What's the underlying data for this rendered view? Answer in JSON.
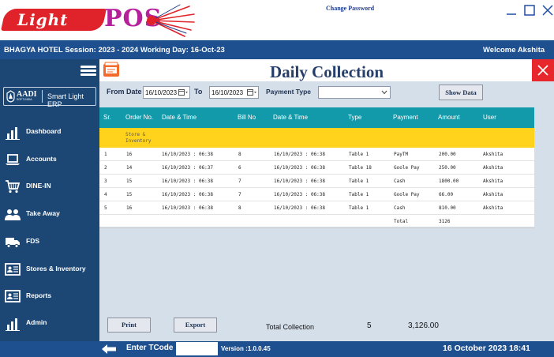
{
  "app": {
    "logo_text_1": "Light",
    "logo_text_2": "POS",
    "change_password": "Change Password"
  },
  "header": {
    "session": "BHAGYA HOTEL  Session:  2023 - 2024 Working Day: 16-Oct-23",
    "welcome": "Welcome  Akshita"
  },
  "sidebar": {
    "brand_short": "AADI",
    "brand_sub": "SOFT-INDIA",
    "brand_name": "Smart Light ERP",
    "items": [
      {
        "label": "Dashboard",
        "icon": "bar-chart-icon"
      },
      {
        "label": "Accounts",
        "icon": "laptop-icon"
      },
      {
        "label": "DINE-IN",
        "icon": "cart-icon"
      },
      {
        "label": "Take Away",
        "icon": "users-icon"
      },
      {
        "label": "FDS",
        "icon": "truck-icon"
      },
      {
        "label": "Stores & Inventory",
        "icon": "id-card-icon"
      },
      {
        "label": "Reports",
        "icon": "report-card-icon"
      },
      {
        "label": "Admin",
        "icon": "admin-chart-icon"
      }
    ]
  },
  "page": {
    "title": "Daily Collection"
  },
  "filters": {
    "from_label": "From Date",
    "from_value": "16/10/2023",
    "to_label": "To",
    "to_value": "16/10/2023",
    "payment_type_label": "Payment Type",
    "payment_type_value": "",
    "show_data_label": "Show Data"
  },
  "grid": {
    "columns": [
      "Sr.",
      "Order No.",
      "Date & Time",
      "Bill No",
      "Date & Time",
      "Type",
      "Payment",
      "Amount",
      "User"
    ],
    "group_label": "Store & Inventory",
    "rows": [
      [
        "1",
        "16",
        "16/10/2023 : 06:38",
        "8",
        "16/10/2023 : 06:38",
        "Table 1",
        "PayTM",
        "200.00",
        "Akshita"
      ],
      [
        "2",
        "14",
        "16/10/2023 : 06:37",
        "6",
        "16/10/2023 : 06:38",
        "Table 18",
        "Goole Pay",
        "250.00",
        "Akshita"
      ],
      [
        "3",
        "15",
        "16/10/2023 : 06:38",
        "7",
        "16/10/2023 : 06:38",
        "Table 1",
        "Cash",
        "1800.00",
        "Akshita"
      ],
      [
        "4",
        "15",
        "16/10/2023 : 06:38",
        "7",
        "16/10/2023 : 06:38",
        "Table 1",
        "Goole Pay",
        "66.00",
        "Akshita"
      ],
      [
        "5",
        "16",
        "16/10/2023 : 06:38",
        "8",
        "16/10/2023 : 06:38",
        "Table 1",
        "Cash",
        "810.00",
        "Akshita"
      ]
    ],
    "total_row": {
      "label": "Total",
      "value": "3126"
    }
  },
  "footer": {
    "print_label": "Print",
    "export_label": "Export",
    "total_collection_label": "Total Collection",
    "total_count": "5",
    "total_amount": "3,126.00"
  },
  "statusbar": {
    "tcode_label": "Enter TCode",
    "tcode_value": "",
    "version": "Version :1.0.0.45",
    "date_time": "16 October 2023   18:41"
  },
  "colors": {
    "brand_blue": "#1e4f8f",
    "sidebar_bg": "#1c4674",
    "grid_header": "#129aaa",
    "group_row": "#ffd31c",
    "close_red": "#e8272c",
    "logo_red": "#e0232a",
    "logo_magenta": "#b5219a"
  }
}
